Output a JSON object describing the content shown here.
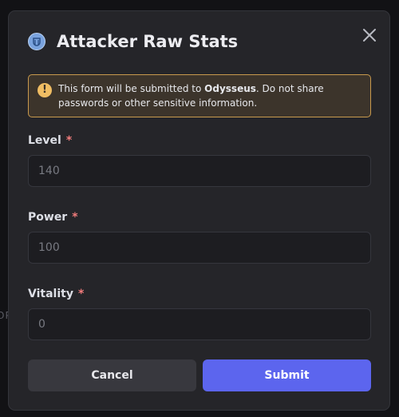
{
  "background": {
    "text": "OP"
  },
  "modal": {
    "title": "Attacker Raw Stats",
    "icon": "app-avatar-icon",
    "close_icon": "close-icon",
    "notice": {
      "prefix": "This form will be submitted to ",
      "app_name": "Odysseus",
      "suffix": ". Do not share passwords or other sensitive information."
    },
    "fields": [
      {
        "label": "Level",
        "required_mark": "*",
        "placeholder": "140"
      },
      {
        "label": "Power",
        "required_mark": "*",
        "placeholder": "100"
      },
      {
        "label": "Vitality",
        "required_mark": "*",
        "placeholder": "0"
      }
    ],
    "buttons": {
      "cancel": "Cancel",
      "submit": "Submit"
    },
    "colors": {
      "accent": "#5c65ee",
      "warning_border": "#c99a4d",
      "required": "#f27c7c"
    }
  }
}
